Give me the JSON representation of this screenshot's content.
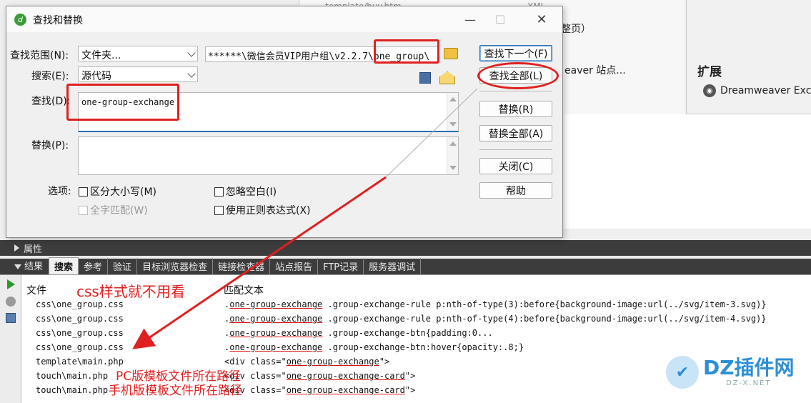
{
  "background": {
    "tab_file": "template/buy.htm",
    "tab_xml": "XML",
    "partial_text_1": "整页）",
    "partial_text_2": "eaver 站点...",
    "extensions_title": "扩展",
    "extension_item": "Dreamweaver Exc"
  },
  "dialog": {
    "title": "查找和替换",
    "scope_label": "查找范围(N):",
    "scope_value": "文件夹...",
    "path_value_a": "******\\微信会员VIP用户组\\v2.2.7\\",
    "path_value_b": "one_group\\",
    "search_label": "搜索(E):",
    "search_value": "源代码",
    "find_label": "查找(D):",
    "find_value": "one-group-exchange",
    "replace_label": "替换(P):",
    "replace_value": "",
    "options_label": "选项:",
    "options": {
      "match_case": "区分大小写(M)",
      "whole_word": "全字匹配(W)",
      "ignore_whitespace": "忽略空白(I)",
      "use_regex": "使用正则表达式(X)"
    },
    "buttons": {
      "find_next": "查找下一个(F)",
      "find_all": "查找全部(L)",
      "replace": "替换(R)",
      "replace_all": "替换全部(A)",
      "close": "关闭(C)",
      "help": "帮助"
    }
  },
  "panels": {
    "properties": "属性",
    "results_label": "结果",
    "tabs": [
      "搜索",
      "参考",
      "验证",
      "目标浏览器检查",
      "链接检查器",
      "站点报告",
      "FTP记录",
      "服务器调试"
    ]
  },
  "results": {
    "col_file": "文件",
    "col_match": "匹配文本",
    "rows": [
      {
        "file": "css\\one_group.css",
        "pre": ".",
        "hit": "one-group-exchange",
        "post": " .group-exchange-rule p:nth-of-type(3):before{background-image:url(../svg/item-3.svg)}"
      },
      {
        "file": "css\\one_group.css",
        "pre": ".",
        "hit": "one-group-exchange",
        "post": " .group-exchange-rule p:nth-of-type(4):before{background-image:url(../svg/item-4.svg)}"
      },
      {
        "file": "css\\one_group.css",
        "pre": ".",
        "hit": "one-group-exchange",
        "post": " .group-exchange-btn{padding:0..."
      },
      {
        "file": "css\\one_group.css",
        "pre": ".",
        "hit": "one-group-exchange",
        "post": " .group-exchange-btn:hover{opacity:.8;}"
      },
      {
        "file": "template\\main.php",
        "pre": "<div class=\"",
        "hit": "one-group-exchange",
        "post": "\">"
      },
      {
        "file": "touch\\main.php",
        "pre": "<div class=\"",
        "hit": "one-group-exchange-card",
        "post": "\">"
      },
      {
        "file": "touch\\main.php",
        "pre": "<div class=\"",
        "hit": "one-group-exchange-card",
        "post": "\">"
      }
    ]
  },
  "annotations": {
    "css_note": "css样式就不用看",
    "pc_note": "PC版模板文件所在路径",
    "mobile_note": "手机版模板文件所在路径"
  },
  "watermark": {
    "title": "DZ插件网",
    "sub": "DZ-X.NET"
  },
  "colors": {
    "annotation_red": "#e02020",
    "panel_bar": "#3c3c3c",
    "accent_blue": "#2a6fb0"
  }
}
